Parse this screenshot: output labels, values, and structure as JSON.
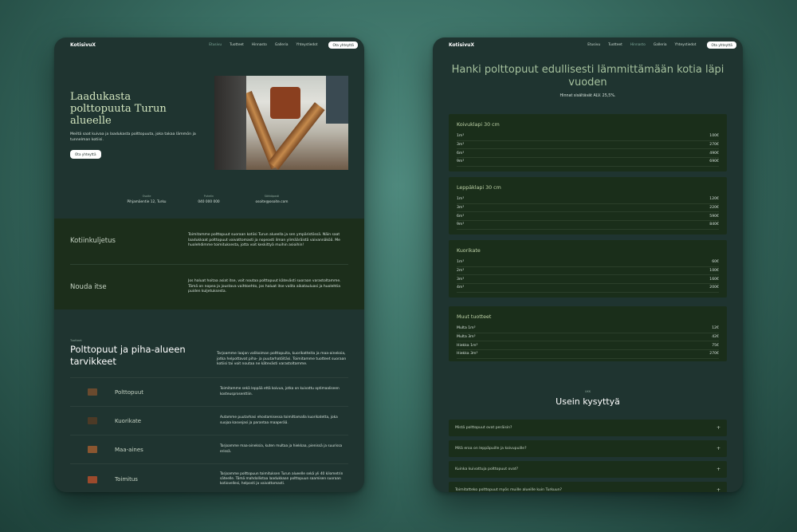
{
  "left": {
    "brand": "KotisivuX",
    "nav": [
      {
        "label": "Etusivu",
        "active": true
      },
      {
        "label": "Tuotteet",
        "active": false
      },
      {
        "label": "Hinnasto",
        "active": false
      },
      {
        "label": "Galleria",
        "active": false
      },
      {
        "label": "Yhteystiedot",
        "active": false
      }
    ],
    "nav_button": "Ota yhteyttä",
    "hero": {
      "title": "Laadukasta polttopuuta Turun alueelle",
      "text": "Meiltä saat kuivaa ja laadukasta polttopuuta, joka takaa lämmön ja tunnelman kotiisi.",
      "button": "Ota yhteyttä"
    },
    "contact": [
      {
        "label": "Osoite",
        "value": "Pihjamäentie 12, Turku"
      },
      {
        "label": "Puhelin",
        "value": "040 000 000"
      },
      {
        "label": "Sähköposti",
        "value": "osoite@osoite.com"
      }
    ],
    "services": [
      {
        "title": "Kotiinkuljetus",
        "text": "Toimitamme polttopuut suoraan kotiisi Turun alueella ja sen ympäristössä. Näin saat laadukkaat polttopuut vaivattomasti ja nopeasti ilman ylimääräistä vaivannäköä. Me huolehdimme toimituksesta, jotta voit keskittyä muihin asioihin!"
      },
      {
        "title": "Nouda itse",
        "text": "Jos haluat hoitaa asiat itse, voit noutaa polttopuut kätevästi suoraan varastoltamme. Tämä on nopea ja joustava vaihtoehto, jos haluat itse valita aikatauluasi ja huolehtia puiden kuljetuksesta."
      }
    ],
    "products_eyebrow": "Tuotteet",
    "products_title": "Polttopuut ja piha-alueen tarvikkeet",
    "products_text": "Tarjoamme laajan valikoiman polttopuita, kuorikatteita ja maa-aineksia, jotka helpottavat piha- ja puutarhatöitäsi. Toimitamme tuotteet suoraan kotiisi tai voit noutaa ne kätevästi varastoltamme.",
    "products": [
      {
        "title": "Polttopuut",
        "text": "Toimitamme sekä leppää että koivua, jotka on kuivattu optimaaliseen kosteusprosenttiin.",
        "icon": "firewood-icon",
        "color": "#6a4a2e"
      },
      {
        "title": "Kuorikate",
        "text": "Autamme puutarhasi ehostamisessa toimittamalla kuorikatetta, joka suojaa kasvejasi ja parantaa maaperää.",
        "icon": "bark-mulch-icon",
        "color": "#4c3a26"
      },
      {
        "title": "Maa-aines",
        "text": "Tarjoamme maa-aineksia, kuten multaa ja hiekkaa, pienissä ja suurissa erissä.",
        "icon": "soil-icon",
        "color": "#8a5630"
      },
      {
        "title": "Toimitus",
        "text": "Tarjoamme polttopuun toimituksen Turun alueelle sekä yli 40 kilometrin säteelle. Tämä mahdollistaa laadukkaan polttopuun saamisen suoraan kotiovellesi, helposti ja vaivattomasti.",
        "icon": "truck-icon",
        "color": "#9c4a2c"
      }
    ]
  },
  "right": {
    "brand": "KotisivuX",
    "nav": [
      {
        "label": "Etusivu",
        "active": false
      },
      {
        "label": "Tuotteet",
        "active": false
      },
      {
        "label": "Hinnasto",
        "active": true
      },
      {
        "label": "Galleria",
        "active": false
      },
      {
        "label": "Yhteystiedot",
        "active": false
      }
    ],
    "nav_button": "Ota yhteyttä",
    "title": "Hanki polttopuut edullisesti lämmittämään kotia läpi vuoden",
    "subtitle": "Hinnat sisältävät ALV. 25,5%.",
    "price_cards": [
      {
        "title": "Koivuklapi 30 cm",
        "rows": [
          [
            "1m³",
            "100€"
          ],
          [
            "3m³",
            "270€"
          ],
          [
            "6m³",
            "490€"
          ],
          [
            "9m³",
            "690€"
          ]
        ]
      },
      {
        "title": "Leppäklapi 30 cm",
        "rows": [
          [
            "1m³",
            "120€"
          ],
          [
            "3m³",
            "220€"
          ],
          [
            "6m³",
            "590€"
          ],
          [
            "9m³",
            "840€"
          ]
        ]
      },
      {
        "title": "Kuorikate",
        "rows": [
          [
            "1m³",
            "60€"
          ],
          [
            "2m³",
            "100€"
          ],
          [
            "3m³",
            "160€"
          ],
          [
            "4m³",
            "200€"
          ]
        ]
      },
      {
        "title": "Muut tuotteet",
        "rows": [
          [
            "Multa 1m³",
            "12€"
          ],
          [
            "Multa 3m³",
            "42€"
          ],
          [
            "Hiekka 1m³",
            "75€"
          ],
          [
            "Hiekka 3m³",
            "270€"
          ]
        ]
      }
    ],
    "faq_eyebrow": "UKK",
    "faq_title": "Usein kysyttyä",
    "faq": [
      "Mistä polttopuut ovat peräisin?",
      "Mitä eroa on leppäpuille ja koivupuille?",
      "Kuinka kuivattuja polttopuut ovat?",
      "Toimitatteko polttopuut myös muille alueille kuin Turkuun?"
    ]
  }
}
